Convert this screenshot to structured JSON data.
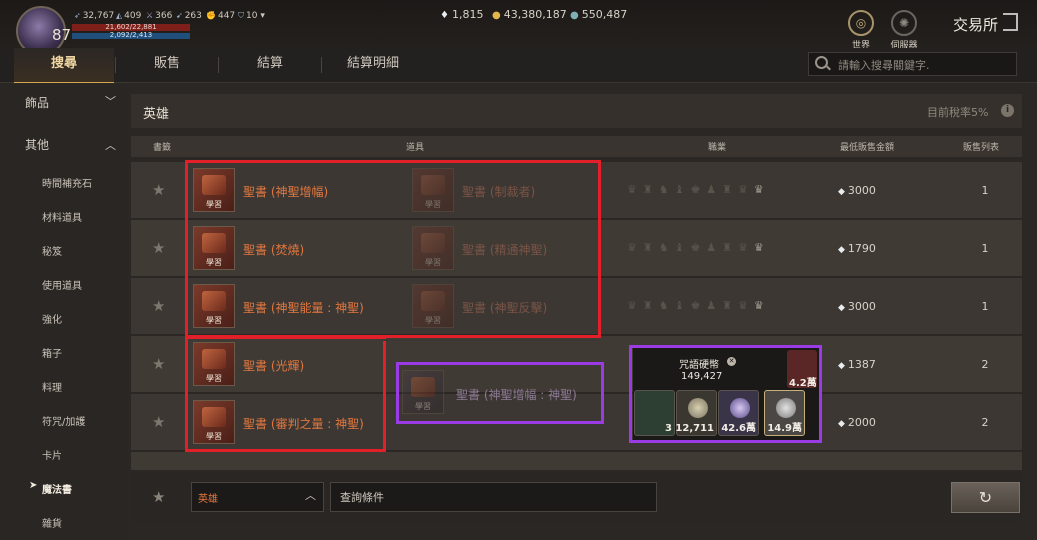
{
  "player": {
    "level": "87",
    "stats": [
      {
        "icon": "wing-icon",
        "value": "32,767"
      },
      {
        "icon": "helmet-icon",
        "value": "409"
      },
      {
        "icon": "sword-icon",
        "value": "366"
      },
      {
        "icon": "bow-icon",
        "value": "263"
      },
      {
        "icon": "fist-icon",
        "value": "447"
      },
      {
        "icon": "shield-icon",
        "value": "10"
      }
    ],
    "hp": "21,602/22,881",
    "mp": "2,092/2,413"
  },
  "currencies": [
    {
      "icon": "diamond-icon",
      "value": "1,815"
    },
    {
      "icon": "gold-coin-icon",
      "value": "43,380,187"
    },
    {
      "icon": "silver-coin-icon",
      "value": "550,487"
    }
  ],
  "top_right": {
    "world_label": "世界",
    "server_label": "伺服器",
    "title": "交易所"
  },
  "tabs": [
    {
      "label": "搜尋",
      "active": true
    },
    {
      "label": "販售",
      "active": false
    },
    {
      "label": "結算",
      "active": false
    },
    {
      "label": "結算明細",
      "active": false
    }
  ],
  "search": {
    "placeholder": "請輸入搜尋關鍵字."
  },
  "sidebar": {
    "categories": [
      {
        "label": "飾品",
        "state": "collapsed"
      },
      {
        "label": "其他",
        "state": "expanded"
      }
    ],
    "items": [
      "時間補充石",
      "材料道具",
      "秘笈",
      "使用道具",
      "強化",
      "箱子",
      "料理",
      "符咒/加護",
      "卡片",
      "魔法書",
      "雜貨"
    ],
    "active_item": "魔法書"
  },
  "main": {
    "header": "英雄",
    "tax": "目前稅率5%",
    "columns": [
      "書籤",
      "道具",
      "職業",
      "最低販售金額",
      "販售列表"
    ],
    "book_badge": "學習",
    "rows": [
      {
        "primary": "聖書 (神聖增幅)",
        "secondary": "聖書 (制裁者)",
        "price": "3000",
        "count": "1"
      },
      {
        "primary": "聖書 (焚燒)",
        "secondary": "聖書 (精通神聖)",
        "price": "1790",
        "count": "1"
      },
      {
        "primary": "聖書 (神聖能量 : 神聖)",
        "secondary": "聖書 (神聖反擊)",
        "price": "3000",
        "count": "1"
      },
      {
        "primary": "聖書 (光輝)",
        "secondary": "",
        "price": "1387",
        "count": "2"
      },
      {
        "primary": "聖書 (審判之量 : 神聖)",
        "secondary": "",
        "price": "2000",
        "count": "2"
      }
    ],
    "drag_item": "聖書 (神聖增幅 : 神聖)"
  },
  "tooltip": {
    "title": "咒語硬幣",
    "amount": "149,427",
    "top_value": "4.2萬",
    "coins": [
      {
        "value": "3",
        "color": "#4a8a5a"
      },
      {
        "value": "12,711",
        "color": "#8e8a7c"
      },
      {
        "value": "42.6萬",
        "color": "#7a6aa8"
      },
      {
        "value": "14.9萬",
        "color": "#9a9a9a"
      }
    ]
  },
  "bottom": {
    "filter_value": "英雄",
    "query_label": "查詢條件"
  },
  "colors": {
    "accent": "#d6a54e",
    "item_text": "#e0773f",
    "highlight_red": "#e3202a",
    "highlight_purple": "#9b3be6"
  }
}
